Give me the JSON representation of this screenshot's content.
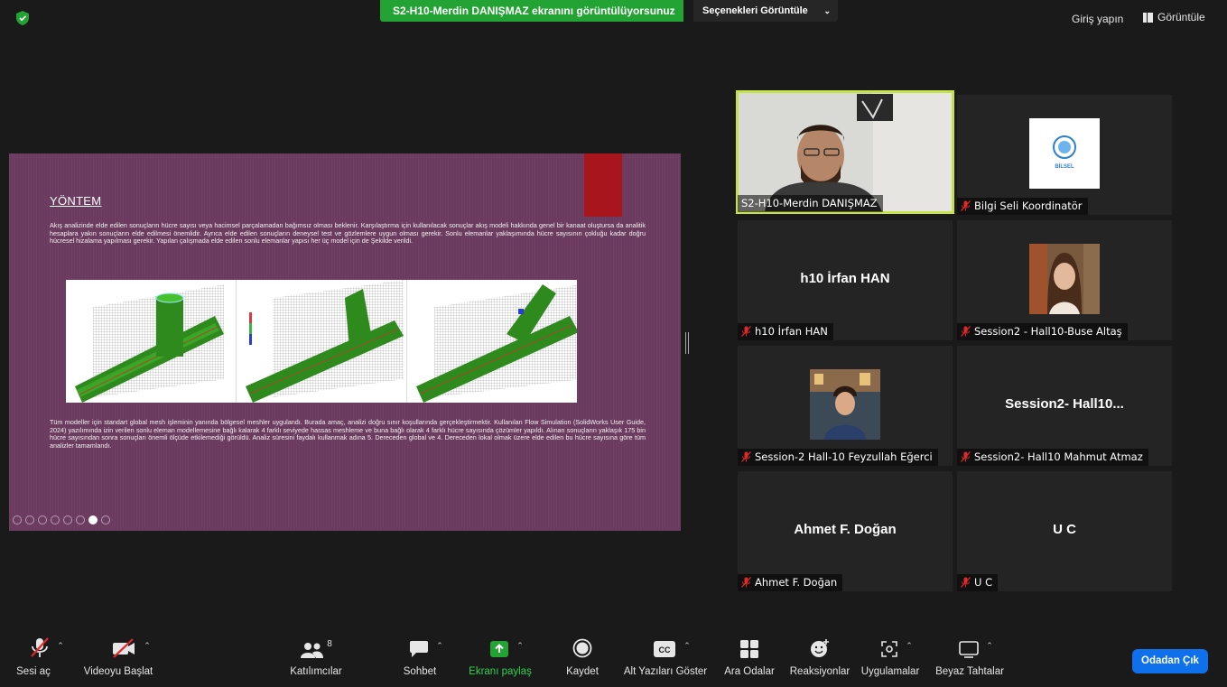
{
  "topbar": {
    "share_banner": "S2-H10-Merdin DANIŞMAZ ekranını görüntülüyorsunuz",
    "view_options": "Seçenekleri Görüntüle",
    "signin": "Giriş yapın",
    "view": "Görüntüle"
  },
  "slide": {
    "heading": "YÖNTEM",
    "paragraph1": "Akış analizinde elde edilen sonuçların hücre sayısı veya hacimsel parçalamadan bağımsız olması beklenir. Karşılaştırma için kullanılacak sonuçlar akış modeli hakkında genel bir kanaat oluştursa da analitik hesaplara yakın sonuçların elde edilmesi önemlidir. Ayrıca elde edilen sonuçların deneysel test ve gözlemlere uygun olması gerekir. Sonlu elemanlar yaklaşımında hücre sayısının çokluğu kadar doğru hücresel hizalama yapılması gerekir. Yapılan çalışmada elde edilen sonlu elemanlar yapısı her üç model için de Şekilde verildi.",
    "paragraph2": "Tüm modeller için standart global mesh işleminin yanında bölgesel meshler uygulandı. Burada amaç, analizi doğru sınır koşullarında gerçekleştirmektir. Kullanılan Flow Simulation (SolidWorks User Guide, 2024) yazılımında izin verilen sonlu eleman modellemesine bağlı kalarak 4 farklı seviyede hassas meshleme ve buna bağlı olarak 4 farklı hücre sayısında çözümler yapıldı. Alınan sonuçların yaklaşık 175 bin hücre sayısından sonra sonuçları önemli ölçüde etkilemediği görüldü. Analiz süresini faydalı kullanmak adına 5. Dereceden global ve 4. Dereceden lokal olmak üzere elde edilen bu hücre sayısına göre tüm analizler tamamlandı."
  },
  "participants": [
    {
      "name": "S2-H10-Merdin DANIŞMAZ",
      "type": "video",
      "muted": false,
      "speaking": true
    },
    {
      "name": "Bilgi Seli Koordinatör",
      "type": "logo",
      "muted": true
    },
    {
      "name": "h10 İrfan HAN",
      "display": "h10 İrfan HAN",
      "type": "text",
      "muted": true
    },
    {
      "name": "Session2 - Hall10-Buse Altaş",
      "type": "photo",
      "muted": true
    },
    {
      "name": "Session-2 Hall-10 Feyzullah Eğerci",
      "type": "photo",
      "muted": true
    },
    {
      "name": "Session2- Hall10 Mahmut Atmaz",
      "display": "Session2-  Hall10...",
      "type": "text",
      "muted": true
    },
    {
      "name": "Ahmet F. Doğan",
      "display": "Ahmet F. Doğan",
      "type": "text",
      "muted": true
    },
    {
      "name": "U C",
      "display": "U C",
      "type": "text",
      "muted": true
    }
  ],
  "logo_text": "BİLSEL",
  "toolbar": {
    "unmute": "Sesi aç",
    "start_video": "Videoyu Başlat",
    "participants": "Katılımcılar",
    "participant_count": "8",
    "chat": "Sohbet",
    "share": "Ekranı paylaş",
    "record": "Kaydet",
    "captions": "Alt Yazıları Göster",
    "captions_icon": "CC",
    "breakout": "Ara Odalar",
    "reactions": "Reaksiyonlar",
    "apps": "Uygulamalar",
    "whiteboards": "Beyaz Tahtalar",
    "leave": "Odadan Çık"
  },
  "colors": {
    "share_green": "#23a334",
    "speaking_outline": "#c6e24a",
    "leave_blue": "#0e71eb",
    "slide_bg": "#6b3a5f",
    "muted_red": "#e02828"
  }
}
